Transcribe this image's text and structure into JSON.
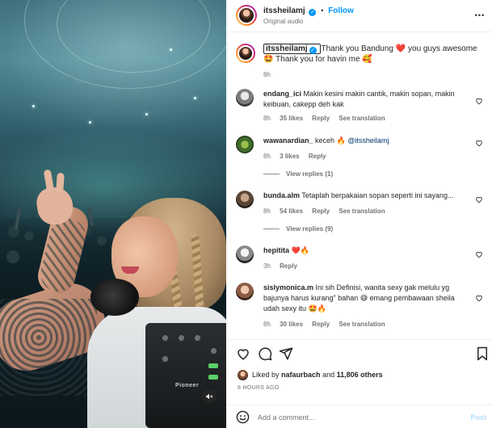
{
  "post": {
    "username": "itssheilamj",
    "follow_label": "Follow",
    "audio_label": "Original audio",
    "separator": "•",
    "more_label": "•••",
    "media_brand": "Pioneer"
  },
  "caption": {
    "username": "itssheilamj",
    "text": "Thank you Bandung ❤️ you guys awesome 🤩 Thank you for havin me 🥰",
    "time": "8h"
  },
  "comments": [
    {
      "username": "endang_ici",
      "text": "Makin kesini makin cantik, makin sopan, makin keibuan, cakepp deh kak",
      "time": "8h",
      "likes": "35 likes",
      "reply": "Reply",
      "translate": "See translation"
    },
    {
      "username": "wawanardian_",
      "text": "keceh 🔥 @itssheilamj",
      "time": "8h",
      "likes": "3 likes",
      "reply": "Reply",
      "view_replies": "View replies (1)"
    },
    {
      "username": "bunda.alm",
      "text": "Tetaplah berpakaian sopan seperti ini sayang...",
      "time": "8h",
      "likes": "54 likes",
      "reply": "Reply",
      "translate": "See translation",
      "view_replies": "View replies (9)"
    },
    {
      "username": "hepitita",
      "text": "❤️🔥",
      "time": "3h",
      "reply": "Reply"
    },
    {
      "username": "sislymonica.m",
      "text": "Ini sih Definisi, wanita sexy gak melulu yg bajunya harus kurang\" bahan 😅 emang pembawaan sheila udah sexy itu 🤩🔥",
      "time": "8h",
      "likes": "30 likes",
      "reply": "Reply",
      "translate": "See translation"
    }
  ],
  "footer": {
    "liked_prefix": "Liked by",
    "liked_user": "nafaurbach",
    "liked_and": "and",
    "liked_count": "11,806 others",
    "ago": "8 HOURS AGO",
    "add_comment_placeholder": "Add a comment...",
    "post_label": "Post"
  },
  "colors": {
    "accent": "#0095f6",
    "like_red": "#ed4956",
    "muted": "#737373"
  },
  "icons": [
    "verified-badge-icon",
    "more-icon",
    "heart-icon",
    "comment-icon",
    "share-icon",
    "bookmark-icon",
    "emoji-icon",
    "mute-icon"
  ]
}
